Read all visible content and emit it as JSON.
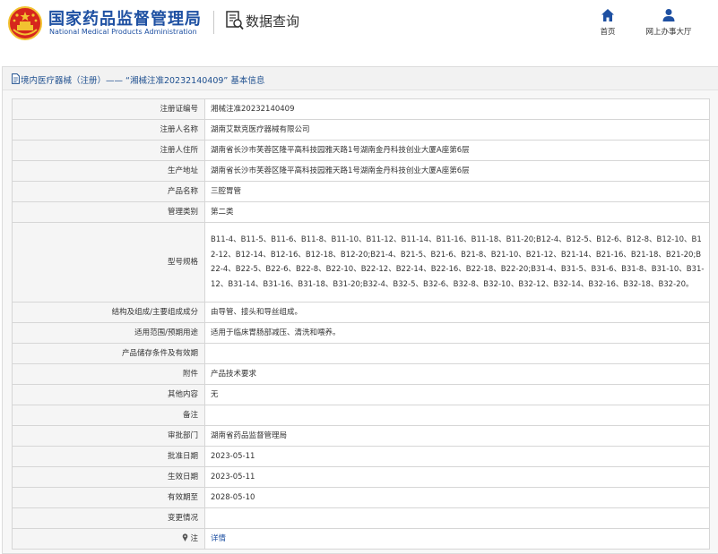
{
  "header": {
    "title_cn": "国家药品监督管理局",
    "title_en": "National Medical Products Administration",
    "query_title": "数据查询",
    "nav": [
      {
        "label": "首页",
        "icon": "home-icon"
      },
      {
        "label": "网上办事大厅",
        "icon": "user-icon"
      }
    ]
  },
  "panel": {
    "title": "境内医疗器械（注册）—— “湘械注准20232140409” 基本信息"
  },
  "table": {
    "rows": [
      {
        "label": "注册证编号",
        "value": "湘械注准20232140409"
      },
      {
        "label": "注册人名称",
        "value": "湖南艾默克医疗器械有限公司"
      },
      {
        "label": "注册人住所",
        "value": "湖南省长沙市芙蓉区隆平高科技园雅天路1号湖南金丹科技创业大厦A座第6层"
      },
      {
        "label": "生产地址",
        "value": "湖南省长沙市芙蓉区隆平高科技园雅天路1号湖南金丹科技创业大厦A座第6层"
      },
      {
        "label": "产品名称",
        "value": "三腔胃管"
      },
      {
        "label": "管理类别",
        "value": "第二类"
      },
      {
        "label": "型号规格",
        "value": "B11-4、B11-5、B11-6、B11-8、B11-10、B11-12、B11-14、B11-16、B11-18、B11-20;B12-4、B12-5、B12-6、B12-8、B12-10、B12-12、B12-14、B12-16、B12-18、B12-20;B21-4、B21-5、B21-6、B21-8、B21-10、B21-12、B21-14、B21-16、B21-18、B21-20;B22-4、B22-5、B22-6、B22-8、B22-10、B22-12、B22-14、B22-16、B22-18、B22-20;B31-4、B31-5、B31-6、B31-8、B31-10、B31-12、B31-14、B31-16、B31-18、B31-20;B32-4、B32-5、B32-6、B32-8、B32-10、B32-12、B32-14、B32-16、B32-18、B32-20。"
      },
      {
        "label": "结构及组成/主要组成成分",
        "value": "由导管、接头和导丝组成。"
      },
      {
        "label": "适用范围/预期用途",
        "value": "适用于临床胃肠部减压、清洗和喂养。"
      },
      {
        "label": "产品储存条件及有效期",
        "value": ""
      },
      {
        "label": "附件",
        "value": "产品技术要求"
      },
      {
        "label": "其他内容",
        "value": "无"
      },
      {
        "label": "备注",
        "value": ""
      },
      {
        "label": "审批部门",
        "value": "湖南省药品监督管理局"
      },
      {
        "label": "批准日期",
        "value": "2023-05-11"
      },
      {
        "label": "生效日期",
        "value": "2023-05-11"
      },
      {
        "label": "有效期至",
        "value": "2028-05-10"
      },
      {
        "label": "变更情况",
        "value": ""
      }
    ],
    "note_row": {
      "label": "注",
      "value": "详情"
    }
  },
  "colors": {
    "brand_blue": "#1e50a2",
    "emblem_red": "#d6261d",
    "emblem_gold": "#f2c230",
    "label_bg": "#f5f5f5",
    "border": "#d6d6d6"
  }
}
